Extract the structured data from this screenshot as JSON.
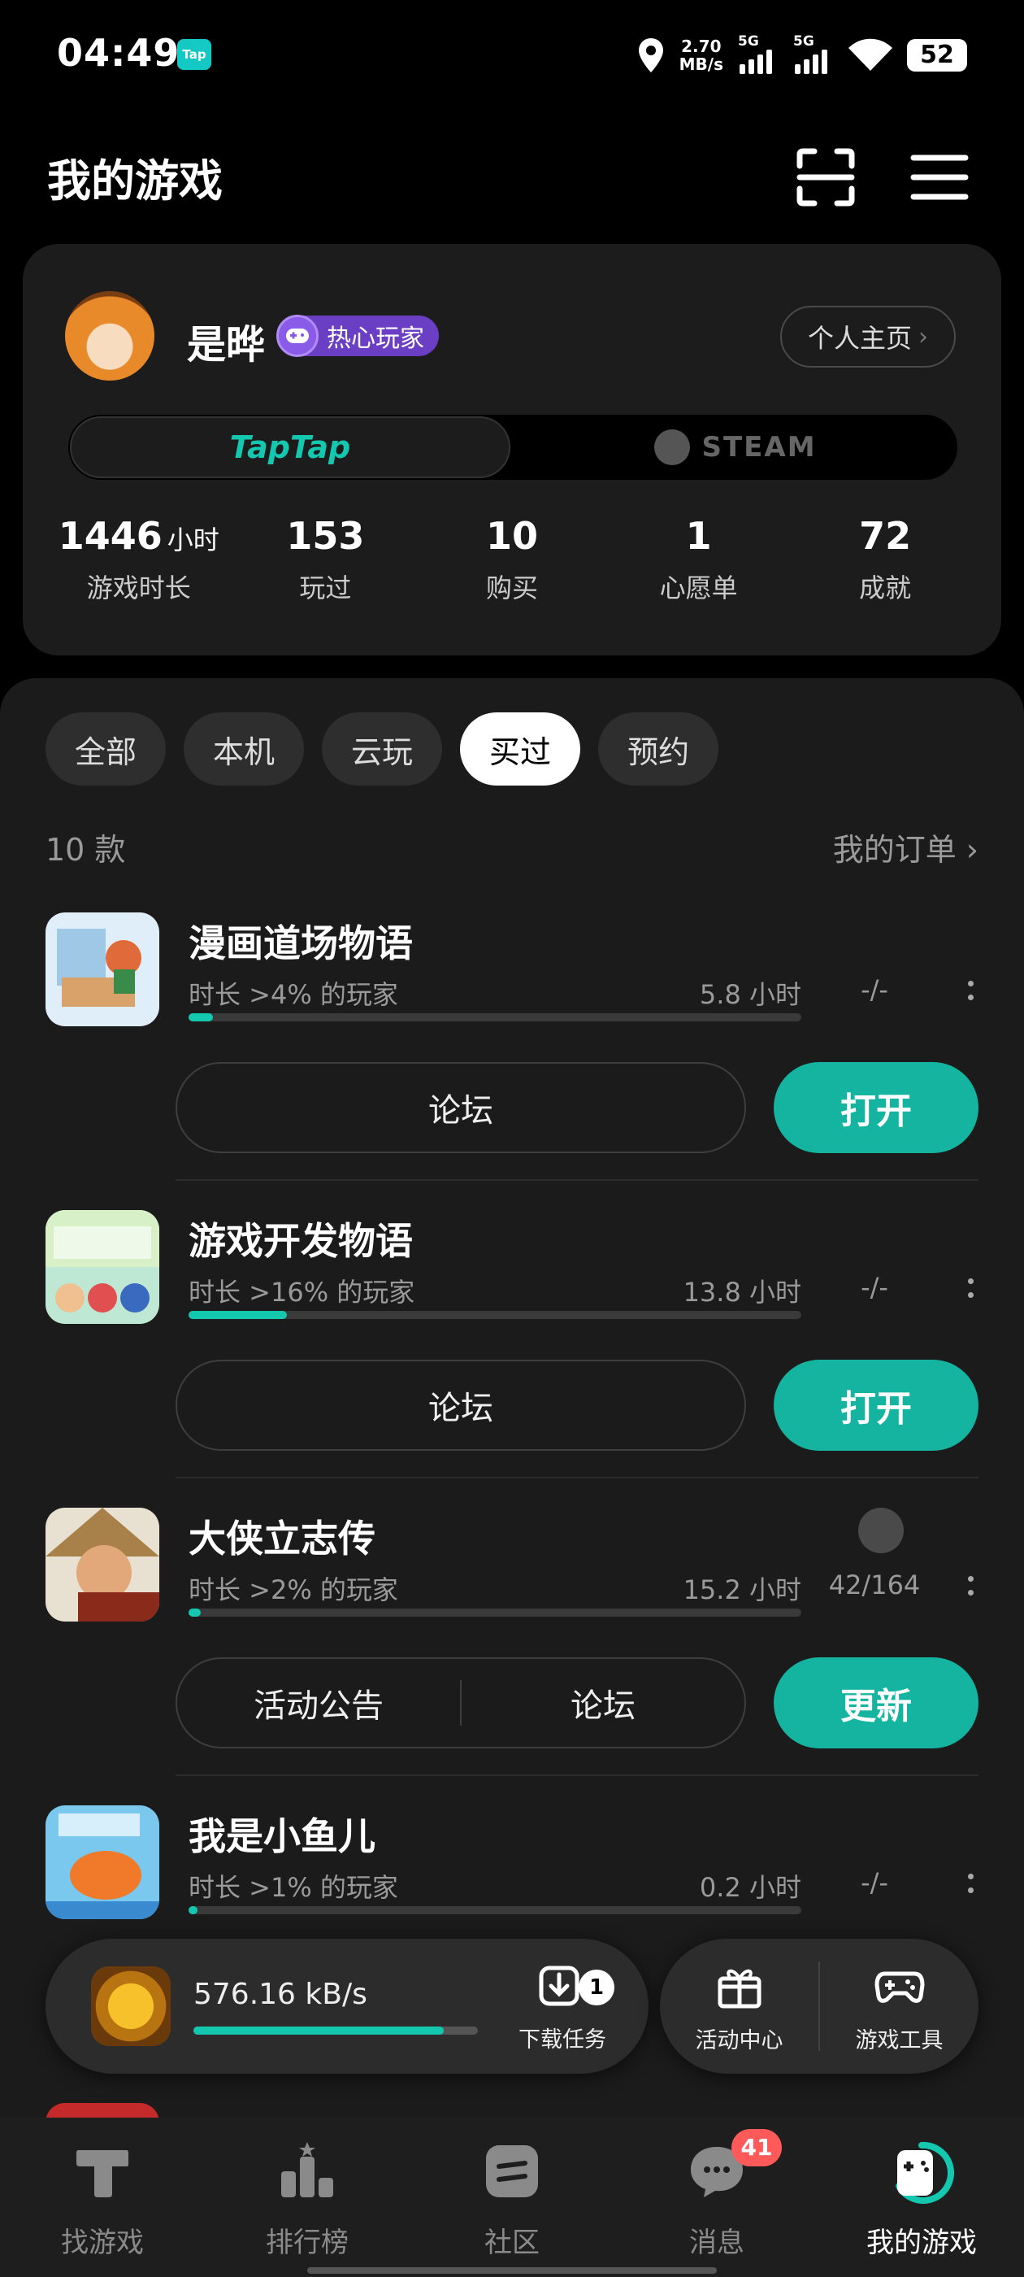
{
  "status_bar": {
    "time": "04:49",
    "app_badge": "Tap",
    "net_speed_value": "2.70",
    "net_speed_unit": "MB/s",
    "signal1_label": "5G",
    "signal2_label": "5G",
    "battery": "52"
  },
  "header": {
    "title": "我的游戏",
    "scan_icon": "scan-icon",
    "menu_icon": "menu-icon"
  },
  "profile": {
    "username": "是晔",
    "badge": "热心玩家",
    "home_button": "个人主页",
    "platform_taptap": "TapTap",
    "platform_steam": "STEAM",
    "stats": [
      {
        "value": "1446",
        "unit": "小时",
        "label": "游戏时长"
      },
      {
        "value": "153",
        "unit": "",
        "label": "玩过"
      },
      {
        "value": "10",
        "unit": "",
        "label": "购买"
      },
      {
        "value": "1",
        "unit": "",
        "label": "心愿单"
      },
      {
        "value": "72",
        "unit": "",
        "label": "成就"
      }
    ]
  },
  "filters": [
    "全部",
    "本机",
    "云玩",
    "买过",
    "预约"
  ],
  "active_filter": "买过",
  "list_header": {
    "count": "10 款",
    "orders_link": "我的订单"
  },
  "games": [
    {
      "name": "漫画道场物语",
      "rank_text": "时长 >4% 的玩家",
      "hours": "5.8 小时",
      "progress": 0.04,
      "achievements": "-/-",
      "secondary": [
        "论坛"
      ],
      "primary": "打开",
      "icon_colors": [
        "#cfe6f5",
        "#e06a3a"
      ]
    },
    {
      "name": "游戏开发物语",
      "rank_text": "时长 >16% 的玩家",
      "hours": "13.8 小时",
      "progress": 0.16,
      "achievements": "-/-",
      "secondary": [
        "论坛"
      ],
      "primary": "打开",
      "icon_colors": [
        "#bfe8d4",
        "#3a6ac0"
      ]
    },
    {
      "name": "大侠立志传",
      "rank_text": "时长 >2% 的玩家",
      "hours": "15.2 小时",
      "progress": 0.02,
      "achievements": "42/164",
      "secondary": [
        "活动公告",
        "论坛"
      ],
      "primary": "更新",
      "icon_colors": [
        "#c8a87a",
        "#8a2a1a"
      ]
    },
    {
      "name": "我是小鱼儿",
      "rank_text": "时长 >1% 的玩家",
      "hours": "0.2 小时",
      "progress": 0.01,
      "achievements": "-/-",
      "secondary": [],
      "primary": "",
      "icon_colors": [
        "#7ac8ee",
        "#f07a2a"
      ]
    }
  ],
  "download": {
    "speed": "576.16 kB/s",
    "progress": 0.88,
    "task_label": "下载任务",
    "task_count": "1"
  },
  "tools": [
    {
      "label": "活动中心",
      "icon": "gift-icon"
    },
    {
      "label": "游戏工具",
      "icon": "gamepad-icon"
    }
  ],
  "bottom_nav": [
    {
      "label": "找游戏",
      "icon": "tap-logo-icon"
    },
    {
      "label": "排行榜",
      "icon": "ranking-icon"
    },
    {
      "label": "社区",
      "icon": "community-icon"
    },
    {
      "label": "消息",
      "icon": "message-icon",
      "badge": "41"
    },
    {
      "label": "我的游戏",
      "icon": "my-games-icon"
    }
  ],
  "colors": {
    "accent": "#14b4a0",
    "badge_purple": "#6b3fc4",
    "msg_badge": "#ff5a5a"
  }
}
